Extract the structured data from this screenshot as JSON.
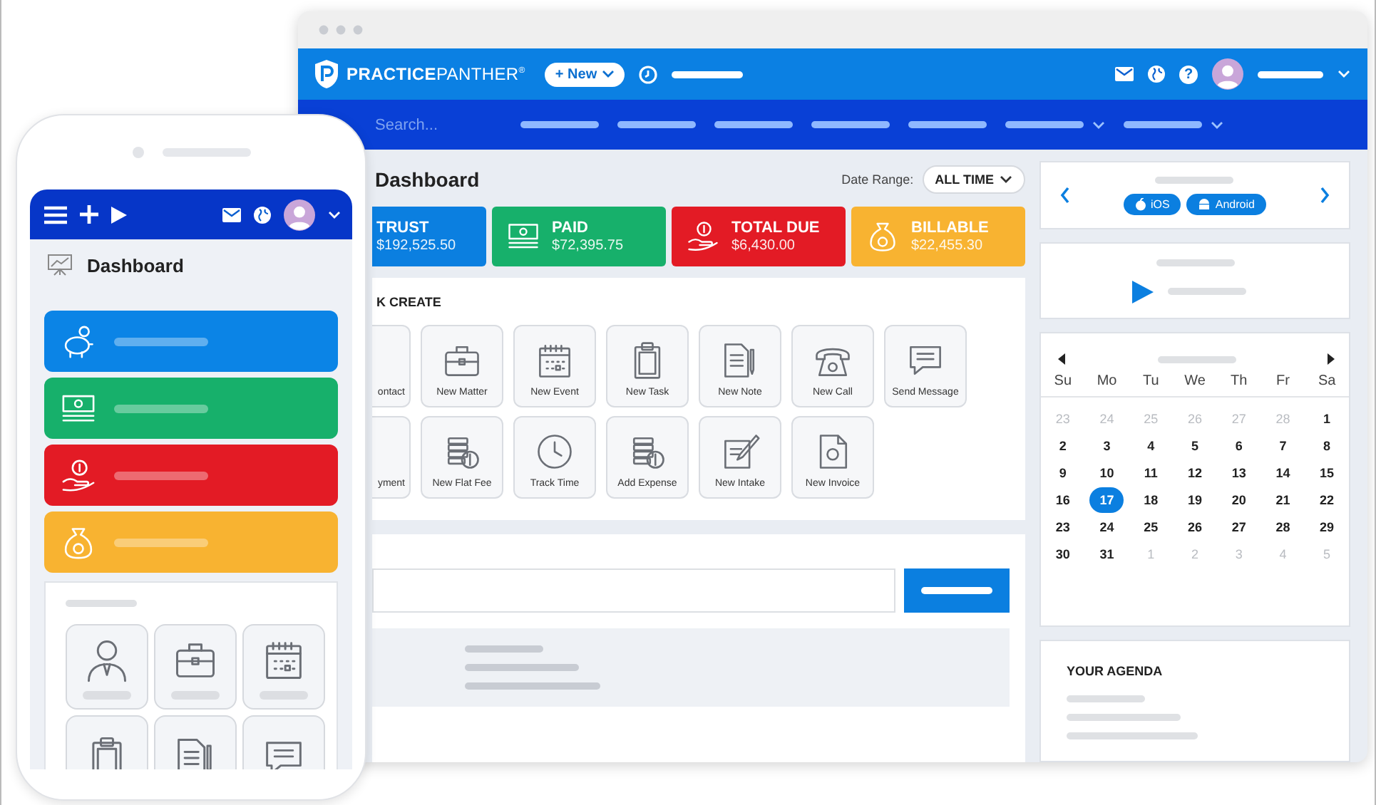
{
  "header": {
    "logo": "**PRACTICE**PANTHER$^{®}$",
    "new_button": "+ New",
    "help_icon": "?"
  },
  "nav": {
    "search_placeholder": "Search...",
    "items": [
      {
        "kind": "link"
      },
      {
        "kind": "link"
      },
      {
        "kind": "link"
      },
      {
        "kind": "link"
      },
      {
        "kind": "link"
      },
      {
        "kind": "menu"
      },
      {
        "kind": "menu"
      }
    ]
  },
  "dashboard": {
    "title": "Dashboard",
    "date_range_label": "Date Range:",
    "date_range_value": "ALL TIME",
    "stats": [
      {
        "label": "TRUST",
        "value": "$192,525.50",
        "color": "#0b7fe0"
      },
      {
        "kind": "paid",
        "label": "PAID",
        "value": "$72,395.75",
        "color": "#17b06b"
      },
      {
        "kind": "due",
        "label": "TOTAL DUE",
        "value": "$6,430.00",
        "color": "#e31b25"
      },
      {
        "kind": "billable",
        "label": "BILLABLE",
        "value": "$22,455.30",
        "color": "#f8b331"
      }
    ],
    "quick_create": {
      "title": "K CREATE",
      "items": [
        {
          "label": "ontact"
        },
        {
          "kind": "matter",
          "label": "New Matter"
        },
        {
          "kind": "event",
          "label": "New Event"
        },
        {
          "kind": "task",
          "label": "New Task"
        },
        {
          "kind": "note",
          "label": "New Note"
        },
        {
          "kind": "call",
          "label": "New Call"
        },
        {
          "kind": "message",
          "label": "Send Message"
        },
        {
          "label": "yment"
        },
        {
          "kind": "flat_fee",
          "label": "New Flat Fee"
        },
        {
          "kind": "time",
          "label": "Track Time"
        },
        {
          "kind": "expense",
          "label": "Add Expense"
        },
        {
          "kind": "intake",
          "label": "New Intake"
        },
        {
          "kind": "invoice",
          "label": "New Invoice"
        }
      ]
    }
  },
  "app_card": {
    "buttons": [
      {
        "kind": "ios",
        "label": "iOS"
      },
      {
        "kind": "android",
        "label": "Android"
      }
    ]
  },
  "calendar": {
    "weekdays": [
      "Su",
      "Mo",
      "Tu",
      "We",
      "Th",
      "Fr",
      "Sa"
    ],
    "weeks": [
      [
        {
          "day": "23",
          "muted": true,
          "selected": false
        },
        {
          "day": "24",
          "muted": true,
          "selected": false
        },
        {
          "day": "25",
          "muted": true,
          "selected": false
        },
        {
          "day": "26",
          "muted": true,
          "selected": false
        },
        {
          "day": "27",
          "muted": true,
          "selected": false
        },
        {
          "day": "28",
          "muted": true,
          "selected": false
        },
        {
          "day": "1",
          "muted": false,
          "selected": false
        }
      ],
      [
        {
          "day": "2",
          "muted": false,
          "selected": false
        },
        {
          "day": "3",
          "muted": false,
          "selected": false
        },
        {
          "day": "4",
          "muted": false,
          "selected": false
        },
        {
          "day": "5",
          "muted": false,
          "selected": false
        },
        {
          "day": "6",
          "muted": false,
          "selected": false
        },
        {
          "day": "7",
          "muted": false,
          "selected": false
        },
        {
          "day": "8",
          "muted": false,
          "selected": false
        }
      ],
      [
        {
          "day": "9",
          "muted": false,
          "selected": false
        },
        {
          "day": "10",
          "muted": false,
          "selected": false
        },
        {
          "day": "11",
          "muted": false,
          "selected": false
        },
        {
          "day": "12",
          "muted": false,
          "selected": false
        },
        {
          "day": "13",
          "muted": false,
          "selected": false
        },
        {
          "day": "14",
          "muted": false,
          "selected": false
        },
        {
          "day": "15",
          "muted": false,
          "selected": false
        }
      ],
      [
        {
          "day": "16",
          "muted": false,
          "selected": false
        },
        {
          "day": "17",
          "muted": false,
          "selected": true
        },
        {
          "day": "18",
          "muted": false,
          "selected": false
        },
        {
          "day": "19",
          "muted": false,
          "selected": false
        },
        {
          "day": "20",
          "muted": false,
          "selected": false
        },
        {
          "day": "21",
          "muted": false,
          "selected": false
        },
        {
          "day": "22",
          "muted": false,
          "selected": false
        }
      ],
      [
        {
          "day": "23",
          "muted": false,
          "selected": false
        },
        {
          "day": "24",
          "muted": false,
          "selected": false
        },
        {
          "day": "25",
          "muted": false,
          "selected": false
        },
        {
          "day": "26",
          "muted": false,
          "selected": false
        },
        {
          "day": "27",
          "muted": false,
          "selected": false
        },
        {
          "day": "28",
          "muted": false,
          "selected": false
        },
        {
          "day": "29",
          "muted": false,
          "selected": false
        }
      ],
      [
        {
          "day": "30",
          "muted": false,
          "selected": false
        },
        {
          "day": "31",
          "muted": false,
          "selected": false
        },
        {
          "day": "1",
          "muted": true,
          "selected": false
        },
        {
          "day": "2",
          "muted": true,
          "selected": false
        },
        {
          "day": "3",
          "muted": true,
          "selected": false
        },
        {
          "day": "4",
          "muted": true,
          "selected": false
        },
        {
          "day": "5",
          "muted": true,
          "selected": false
        }
      ]
    ]
  },
  "agenda": {
    "title": "YOUR AGENDA"
  },
  "phone": {
    "title": "Dashboard",
    "cards": [
      {
        "kind": "trust",
        "color": "#0b84e6"
      },
      {
        "kind": "paid",
        "color": "#17b06b"
      },
      {
        "kind": "due",
        "color": "#e31b25"
      },
      {
        "kind": "billable",
        "color": "#f8b331"
      }
    ],
    "tiles": [
      {
        "kind": "contact"
      },
      {
        "kind": "matter"
      },
      {
        "kind": "event"
      },
      {
        "kind": "task"
      },
      {
        "kind": "note"
      },
      {
        "kind": "message"
      }
    ]
  }
}
